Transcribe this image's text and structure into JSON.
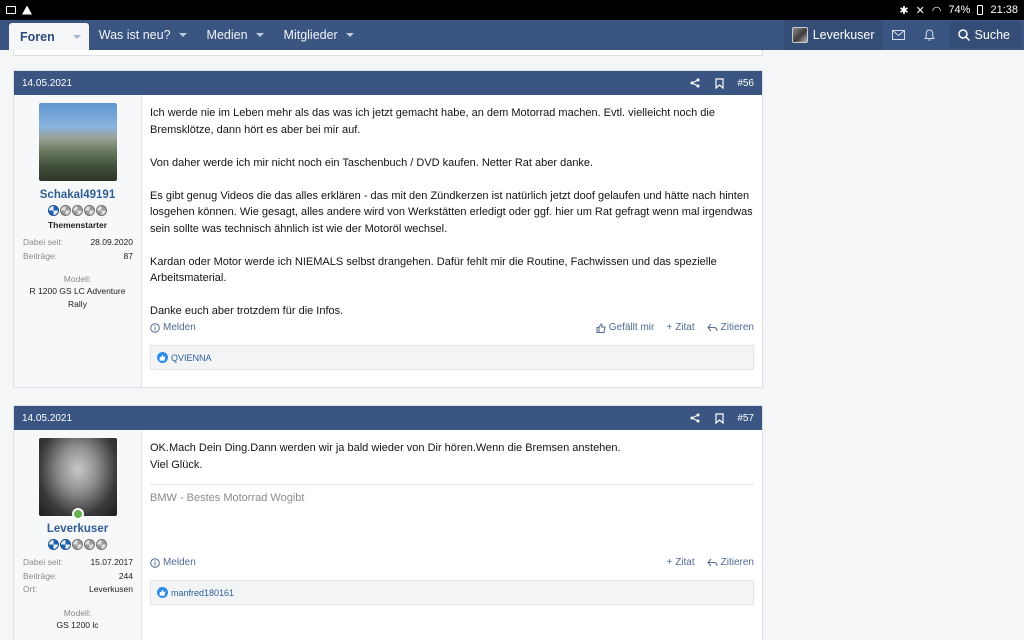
{
  "status_bar": {
    "battery": "74%",
    "time": "21:38"
  },
  "nav": {
    "items": [
      {
        "label": "Foren",
        "active": true
      },
      {
        "label": "Was ist neu?"
      },
      {
        "label": "Medien"
      },
      {
        "label": "Mitglieder"
      }
    ],
    "username": "Leverkuser",
    "search_label": "Suche"
  },
  "posts": [
    {
      "date": "14.05.2021",
      "number": "#56",
      "user": {
        "name": "Schakal49191",
        "rank_filled": 1,
        "title": "Themenstarter",
        "stats": [
          {
            "label": "Dabei seit:",
            "value": "28.09.2020"
          },
          {
            "label": "Beiträge:",
            "value": "87"
          }
        ],
        "extra_label": "Modell:",
        "extra_value": "R 1200 GS LC Adventure Rally"
      },
      "paragraphs": [
        "Ich werde nie im Leben mehr als das was ich jetzt gemacht habe, an dem Motorrad machen. Evtl. vielleicht noch die Bremsklötze, dann hört es aber bei mir auf.",
        "Von daher werde ich mir nicht noch ein Taschenbuch / DVD kaufen. Netter Rat aber danke.",
        "Es gibt genug Videos die das alles erklären - das mit den Zündkerzen ist natürlich jetzt doof gelaufen und hätte nach hinten losgehen können. Wie gesagt, alles andere wird von Werkstätten erledigt oder ggf. hier um Rat gefragt wenn mal irgendwas sein sollte was technisch ähnlich ist wie der Motoröl wechsel.",
        "Kardan oder Motor werde ich NIEMALS selbst drangehen. Dafür fehlt mir die Routine, Fachwissen und das spezielle Arbeitsmaterial.",
        "Danke euch aber trotzdem für die Infos."
      ],
      "actions": {
        "report": "Melden",
        "like": "Gefällt mir",
        "quote": "Zitat",
        "reply": "Zitieren"
      },
      "reactions": "QVIENNA"
    },
    {
      "date": "14.05.2021",
      "number": "#57",
      "user": {
        "name": "Leverkuser",
        "rank_filled": 2,
        "online": true,
        "stats": [
          {
            "label": "Dabei seit:",
            "value": "15.07.2017"
          },
          {
            "label": "Beiträge:",
            "value": "244"
          },
          {
            "label": "Ort:",
            "value": "Leverkusen"
          }
        ],
        "extra_label": "Modell:",
        "extra_value": "GS 1200 lc"
      },
      "paragraphs": [
        "OK.Mach Dein Ding.Dann werden wir ja bald wieder von Dir hören.Wenn die Bremsen anstehen.",
        "Viel Glück."
      ],
      "signature": "BMW - Bestes Motorrad Wogibt",
      "actions": {
        "report": "Melden",
        "quote": "Zitat",
        "reply": "Zitieren"
      },
      "reactions": "manfred180161"
    }
  ]
}
